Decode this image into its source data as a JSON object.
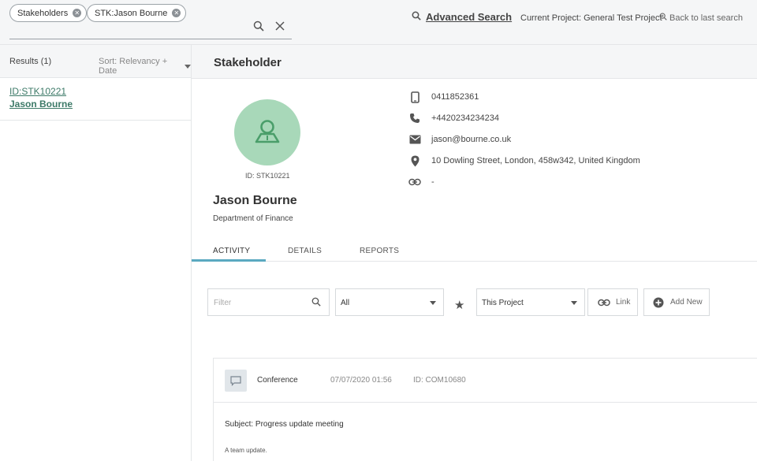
{
  "search": {
    "chips": [
      {
        "label": "Stakeholders"
      },
      {
        "label": "STK:Jason Bourne"
      }
    ]
  },
  "header": {
    "advanced_search": "Advanced Search",
    "current_project": "Current Project: General Test Project",
    "back_to_last_search": "Back to last search"
  },
  "results": {
    "count_label": "Results (1)",
    "sort_label": "Sort: Relevancy + Date",
    "items": [
      {
        "id": "ID:STK10221",
        "name": "Jason Bourne"
      }
    ]
  },
  "stakeholder": {
    "section_title": "Stakeholder",
    "id_label": "ID: STK10221",
    "name": "Jason Bourne",
    "department": "Department of Finance",
    "mobile": "0411852361",
    "phone": "+4420234234234",
    "email": "jason@bourne.co.uk",
    "address": "10 Dowling Street, London, 458w342, United Kingdom",
    "link": "-"
  },
  "tabs": [
    {
      "label": "ACTIVITY",
      "active": true
    },
    {
      "label": "DETAILS",
      "active": false
    },
    {
      "label": "REPORTS",
      "active": false
    }
  ],
  "toolbar": {
    "filter_placeholder": "Filter",
    "type_select": "All",
    "project_select": "This Project",
    "link_label": "Link",
    "add_new_label": "Add New"
  },
  "activity": {
    "type": "Conference",
    "datetime": "07/07/2020 01:56",
    "id": "ID: COM10680",
    "subject": "Subject: Progress update meeting",
    "body": "A team update."
  },
  "colors": {
    "accent": "#5aa9c0",
    "avatar_bg": "#a8d8b9",
    "link_green": "#3d7a68"
  }
}
